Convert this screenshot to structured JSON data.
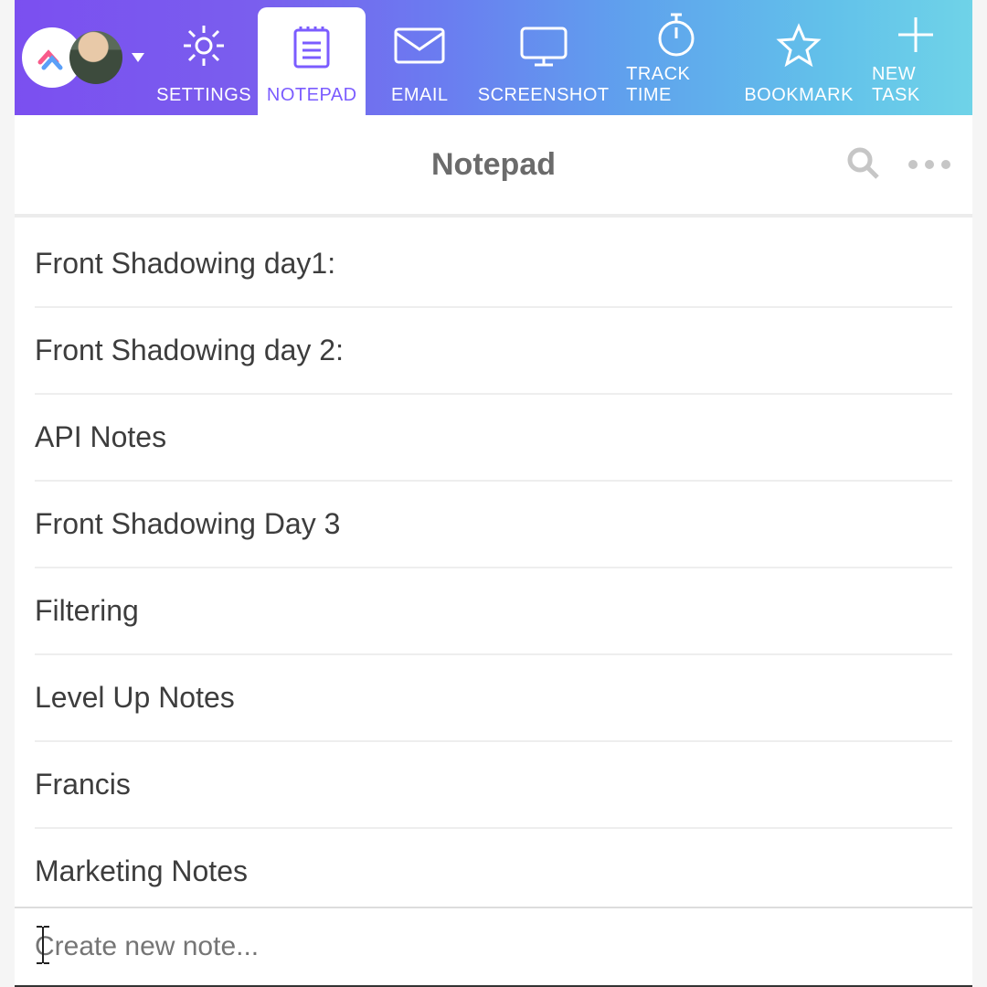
{
  "toolbar": {
    "items": [
      {
        "id": "settings",
        "label": "SETTINGS",
        "active": false
      },
      {
        "id": "notepad",
        "label": "NOTEPAD",
        "active": true
      },
      {
        "id": "email",
        "label": "EMAIL",
        "active": false
      },
      {
        "id": "screenshot",
        "label": "SCREENSHOT",
        "active": false
      },
      {
        "id": "tracktime",
        "label": "TRACK TIME",
        "active": false
      },
      {
        "id": "bookmark",
        "label": "BOOKMARK",
        "active": false
      },
      {
        "id": "newtask",
        "label": "NEW TASK",
        "active": false
      }
    ]
  },
  "page": {
    "title": "Notepad"
  },
  "notes": [
    {
      "title": "Front Shadowing day1:"
    },
    {
      "title": "Front Shadowing day 2:"
    },
    {
      "title": "API Notes"
    },
    {
      "title": "Front Shadowing Day 3"
    },
    {
      "title": "Filtering"
    },
    {
      "title": "Level Up Notes"
    },
    {
      "title": "Francis"
    },
    {
      "title": "Marketing Notes"
    }
  ],
  "create": {
    "placeholder": "Create new note..."
  }
}
